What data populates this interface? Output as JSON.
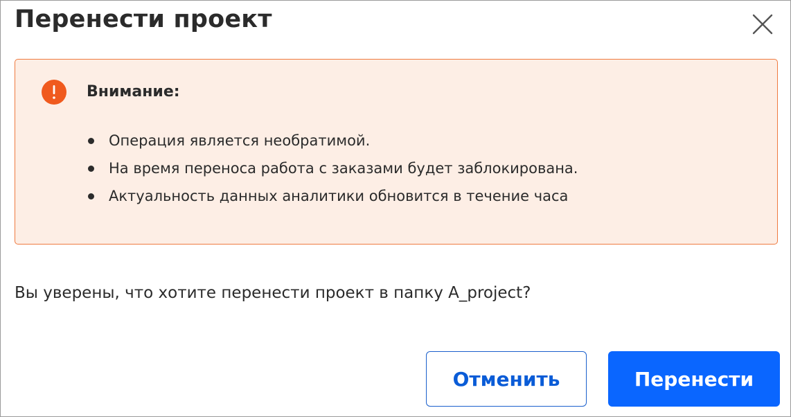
{
  "dialog": {
    "title": "Перенести проект",
    "close_icon": "close-icon"
  },
  "warning": {
    "icon": "exclamation-circle-icon",
    "icon_color": "#f05a1e",
    "title": "Внимание:",
    "items": [
      "Операция является необратимой.",
      "На время переноса работа с заказами будет заблокирована.",
      "Актуальность данных аналитики обновится в течение часа"
    ],
    "background_color": "#fdeee5",
    "border_color": "#ef7a3f"
  },
  "question": "Вы уверены, что хотите перенести проект в папку A_project?",
  "buttons": {
    "cancel_label": "Отменить",
    "confirm_label": "Перенести",
    "accent_color": "#0a66ff"
  }
}
